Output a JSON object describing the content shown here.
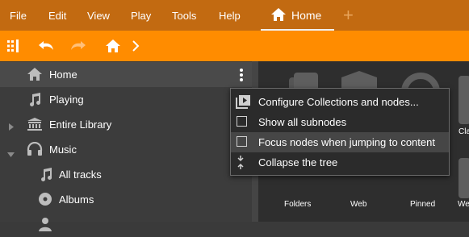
{
  "menubar": {
    "items": [
      "File",
      "Edit",
      "View",
      "Play",
      "Tools",
      "Help"
    ],
    "tabs": [
      {
        "label": "Home",
        "icon": "home-icon",
        "active": true
      }
    ],
    "add_tab_icon": "plus-icon"
  },
  "toolbar": {
    "buttons": [
      "sidebar-toggle-icon",
      "undo-icon",
      "redo-icon",
      "home-icon",
      "chevron-right-icon"
    ]
  },
  "sidebar": {
    "items": [
      {
        "label": "Home",
        "icon": "home-icon",
        "selected": true
      },
      {
        "label": "Playing",
        "icon": "music-note-icon"
      },
      {
        "label": "Entire Library",
        "icon": "library-icon",
        "expander": "collapsed"
      },
      {
        "label": "Music",
        "icon": "headphones-icon",
        "expander": "expanded"
      },
      {
        "label": "All tracks",
        "icon": "music-note-icon"
      },
      {
        "label": "Albums",
        "icon": "disc-icon"
      }
    ]
  },
  "context_menu": {
    "items": [
      {
        "label": "Configure Collections and nodes...",
        "icon": "play-collection-icon"
      },
      {
        "label": "Show all subnodes",
        "icon": "checkbox"
      },
      {
        "label": "Focus nodes when jumping to content",
        "icon": "checkbox",
        "hover": true
      },
      {
        "label": "Collapse the tree",
        "icon": "collapse-icon"
      }
    ]
  },
  "content": {
    "tiles": [
      {
        "label": "Folders",
        "icon": "folder-icon"
      },
      {
        "label": "Web",
        "icon": "globe-icon"
      },
      {
        "label": "Pinned",
        "icon": "search-icon"
      },
      {
        "label": "Cla",
        "icon": "tile-icon"
      },
      {
        "label": "We",
        "icon": "tile-icon"
      }
    ]
  },
  "colors": {
    "menubar": "#c26a11",
    "toolbar": "#ff8c00",
    "sidebar": "#3c3c3c",
    "content": "#2e2e2e",
    "popup": "#2b2b2b"
  }
}
